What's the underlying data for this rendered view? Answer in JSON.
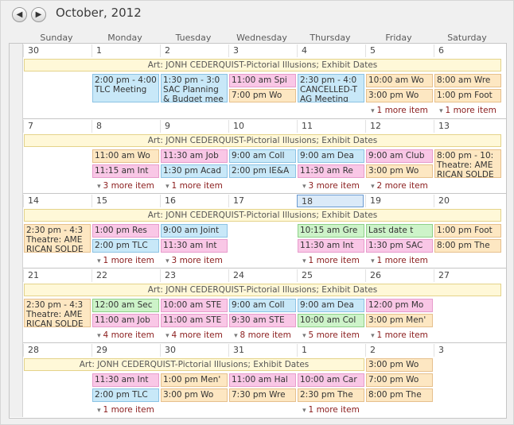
{
  "title": "October, 2012",
  "nav": {
    "prev_icon": "◀",
    "next_icon": "▶"
  },
  "weekdays": [
    "Sunday",
    "Monday",
    "Tuesday",
    "Wednesday",
    "Thursday",
    "Friday",
    "Saturday"
  ],
  "colors": {
    "blue": "#c8e8f8",
    "pink": "#f9c7e6",
    "orange": "#fde7c2",
    "green": "#cdf3c9",
    "exhibit": "#fff8d8"
  },
  "weeks": [
    {
      "days": [
        "30",
        "1",
        "2",
        "3",
        "4",
        "5",
        "6"
      ],
      "exhibit": {
        "text": "Art: JONH CEDERQUIST-Pictorial Illusions; Exhibit Dates",
        "start_day": 0,
        "span_days": 7
      },
      "events": [
        {
          "day": 1,
          "slot": 0,
          "tall": true,
          "color": "blue",
          "text": "2:00 pm - 4:00 TLC Meeting"
        },
        {
          "day": 2,
          "slot": 0,
          "tall": true,
          "color": "blue",
          "text": "1:30 pm - 3:0 SAC Planning & Budget mee"
        },
        {
          "day": 3,
          "slot": 0,
          "color": "pink",
          "text": "11:00 am Spi"
        },
        {
          "day": 3,
          "slot": 1,
          "color": "orange",
          "text": "7:00 pm Wo"
        },
        {
          "day": 4,
          "slot": 0,
          "tall": true,
          "color": "blue",
          "text": "2:30 pm - 4:0 CANCELLED-T AG Meeting"
        },
        {
          "day": 5,
          "slot": 0,
          "color": "orange",
          "text": "10:00 am Wo"
        },
        {
          "day": 5,
          "slot": 1,
          "color": "orange",
          "text": "3:00 pm Wo"
        },
        {
          "day": 6,
          "slot": 0,
          "color": "orange",
          "text": "8:00 am Wre"
        },
        {
          "day": 6,
          "slot": 1,
          "color": "orange",
          "text": "1:00 pm Foot"
        }
      ],
      "more": [
        {
          "day": 5,
          "text": "1 more item"
        },
        {
          "day": 6,
          "text": "1 more item"
        }
      ]
    },
    {
      "days": [
        "7",
        "8",
        "9",
        "10",
        "11",
        "12",
        "13"
      ],
      "exhibit": {
        "text": "Art: JONH CEDERQUIST-Pictorial Illusions; Exhibit Dates",
        "start_day": 0,
        "span_days": 7
      },
      "events": [
        {
          "day": 1,
          "slot": 0,
          "color": "orange",
          "text": "11:00 am Wo"
        },
        {
          "day": 1,
          "slot": 1,
          "color": "pink",
          "text": "11:15 am Int"
        },
        {
          "day": 2,
          "slot": 0,
          "color": "pink",
          "text": "11:30 am Job"
        },
        {
          "day": 2,
          "slot": 1,
          "color": "blue",
          "text": "1:30 pm Acad"
        },
        {
          "day": 3,
          "slot": 0,
          "color": "blue",
          "text": "9:00 am Coll"
        },
        {
          "day": 3,
          "slot": 1,
          "color": "blue",
          "text": "2:00 pm IE&A"
        },
        {
          "day": 4,
          "slot": 0,
          "color": "blue",
          "text": "9:00 am Dea"
        },
        {
          "day": 4,
          "slot": 1,
          "color": "pink",
          "text": "11:30 am Re"
        },
        {
          "day": 5,
          "slot": 0,
          "color": "pink",
          "text": "9:00 am Club"
        },
        {
          "day": 5,
          "slot": 1,
          "color": "orange",
          "text": "3:00 pm Wo"
        },
        {
          "day": 6,
          "slot": 0,
          "tall": true,
          "color": "orange",
          "text": "8:00 pm - 10: Theatre: AME RICAN SOLDE"
        }
      ],
      "more": [
        {
          "day": 1,
          "text": "3 more item"
        },
        {
          "day": 2,
          "text": "1 more item"
        },
        {
          "day": 4,
          "text": "3 more item"
        },
        {
          "day": 5,
          "text": "2 more item"
        }
      ]
    },
    {
      "days": [
        "14",
        "15",
        "16",
        "17",
        "18",
        "19",
        "20"
      ],
      "today_day": 4,
      "exhibit": {
        "text": "Art: JONH CEDERQUIST-Pictorial Illusions; Exhibit Dates",
        "start_day": 0,
        "span_days": 7
      },
      "events": [
        {
          "day": 0,
          "slot": 0,
          "tall": true,
          "color": "orange",
          "text": "2:30 pm - 4:3 Theatre: AME RICAN SOLDE"
        },
        {
          "day": 1,
          "slot": 0,
          "color": "pink",
          "text": "1:00 pm Res"
        },
        {
          "day": 1,
          "slot": 1,
          "color": "blue",
          "text": "2:00 pm TLC"
        },
        {
          "day": 2,
          "slot": 0,
          "color": "blue",
          "text": "9:00 am Joint"
        },
        {
          "day": 2,
          "slot": 1,
          "color": "pink",
          "text": "11:30 am Int"
        },
        {
          "day": 4,
          "slot": 0,
          "color": "green",
          "text": "10:15 am Gre"
        },
        {
          "day": 4,
          "slot": 1,
          "color": "pink",
          "text": "11:30 am Int"
        },
        {
          "day": 5,
          "slot": 0,
          "color": "green",
          "text": "Last date t"
        },
        {
          "day": 5,
          "slot": 1,
          "color": "pink",
          "text": "1:30 pm SAC"
        },
        {
          "day": 6,
          "slot": 0,
          "color": "orange",
          "text": "1:00 pm Foot"
        },
        {
          "day": 6,
          "slot": 1,
          "color": "orange",
          "text": "8:00 pm The"
        }
      ],
      "more": [
        {
          "day": 1,
          "text": "1 more item"
        },
        {
          "day": 2,
          "text": "3 more item"
        },
        {
          "day": 4,
          "text": "1 more item"
        },
        {
          "day": 5,
          "text": "1 more item"
        }
      ]
    },
    {
      "days": [
        "21",
        "22",
        "23",
        "24",
        "25",
        "26",
        "27"
      ],
      "exhibit": {
        "text": "Art: JONH CEDERQUIST-Pictorial Illusions; Exhibit Dates",
        "start_day": 0,
        "span_days": 7
      },
      "events": [
        {
          "day": 0,
          "slot": 0,
          "tall": true,
          "color": "orange",
          "text": "2:30 pm - 4:3 Theatre: AME RICAN SOLDE"
        },
        {
          "day": 1,
          "slot": 0,
          "color": "green",
          "text": "12:00 am Sec"
        },
        {
          "day": 1,
          "slot": 1,
          "color": "pink",
          "text": "11:00 am Job"
        },
        {
          "day": 2,
          "slot": 0,
          "color": "pink",
          "text": "10:00 am STE"
        },
        {
          "day": 2,
          "slot": 1,
          "color": "pink",
          "text": "11:00 am STE"
        },
        {
          "day": 3,
          "slot": 0,
          "color": "blue",
          "text": "9:00 am Coll"
        },
        {
          "day": 3,
          "slot": 1,
          "color": "pink",
          "text": "9:30 am STE"
        },
        {
          "day": 4,
          "slot": 0,
          "color": "blue",
          "text": "9:00 am Dea"
        },
        {
          "day": 4,
          "slot": 1,
          "color": "green",
          "text": "10:00 am Col"
        },
        {
          "day": 5,
          "slot": 0,
          "color": "pink",
          "text": "12:00 pm Mo"
        },
        {
          "day": 5,
          "slot": 1,
          "color": "orange",
          "text": "3:00 pm Men'"
        }
      ],
      "more": [
        {
          "day": 1,
          "text": "4 more item"
        },
        {
          "day": 2,
          "text": "4 more item"
        },
        {
          "day": 3,
          "text": "8 more item"
        },
        {
          "day": 4,
          "text": "5 more item"
        },
        {
          "day": 5,
          "text": "1 more item"
        }
      ]
    },
    {
      "days": [
        "28",
        "29",
        "30",
        "31",
        "1",
        "2",
        "3"
      ],
      "exhibit": {
        "text": "Art: JONH CEDERQUIST-Pictorial Illusions; Exhibit Dates",
        "start_day": 0,
        "span_days": 5
      },
      "events": [
        {
          "day": 5,
          "slot": -1,
          "color": "orange",
          "text": "3:00 pm Wo"
        },
        {
          "day": 1,
          "slot": 0,
          "color": "pink",
          "text": "11:30 am Int"
        },
        {
          "day": 1,
          "slot": 1,
          "color": "blue",
          "text": "2:00 pm TLC"
        },
        {
          "day": 2,
          "slot": 0,
          "color": "orange",
          "text": "1:00 pm Men'"
        },
        {
          "day": 2,
          "slot": 1,
          "color": "orange",
          "text": "3:00 pm Wo"
        },
        {
          "day": 3,
          "slot": 0,
          "color": "pink",
          "text": "11:00 am Hal"
        },
        {
          "day": 3,
          "slot": 1,
          "color": "orange",
          "text": "7:30 pm Wre"
        },
        {
          "day": 4,
          "slot": 0,
          "color": "pink",
          "text": "10:00 am Car"
        },
        {
          "day": 4,
          "slot": 1,
          "color": "orange",
          "text": "2:30 pm The"
        },
        {
          "day": 5,
          "slot": 0,
          "color": "orange",
          "text": "7:00 pm Wo"
        },
        {
          "day": 5,
          "slot": 1,
          "color": "orange",
          "text": "8:00 pm The"
        }
      ],
      "more": [
        {
          "day": 1,
          "text": "1 more item"
        },
        {
          "day": 4,
          "text": "1 more item"
        }
      ]
    }
  ]
}
